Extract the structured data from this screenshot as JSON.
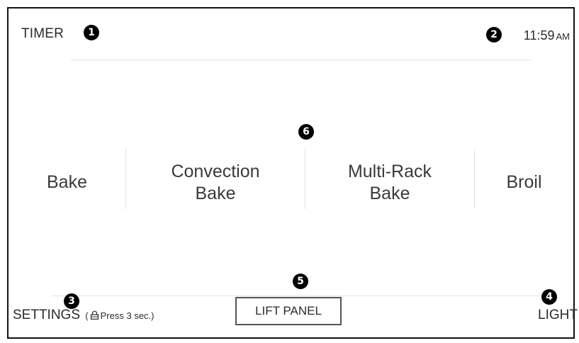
{
  "header": {
    "timer_label": "TIMER",
    "clock_time": "11:59",
    "clock_period": "AM"
  },
  "modes": [
    {
      "line1": "Bake",
      "line2": ""
    },
    {
      "line1": "Convection",
      "line2": "Bake"
    },
    {
      "line1": "Multi-Rack",
      "line2": "Bake"
    },
    {
      "line1": "Broil",
      "line2": ""
    }
  ],
  "footer": {
    "settings_label": "SETTINGS",
    "settings_hint_open": "(",
    "settings_hint_text": "Press 3 sec.)",
    "lift_panel_label": "LIFT PANEL",
    "light_label": "LIGHT"
  },
  "callouts": [
    "1",
    "2",
    "3",
    "4",
    "5",
    "6"
  ],
  "colors": {
    "callout_fill": "#000000",
    "text": "#2b2b2b",
    "divider": "#e3e3e3",
    "frame": "#111111"
  }
}
